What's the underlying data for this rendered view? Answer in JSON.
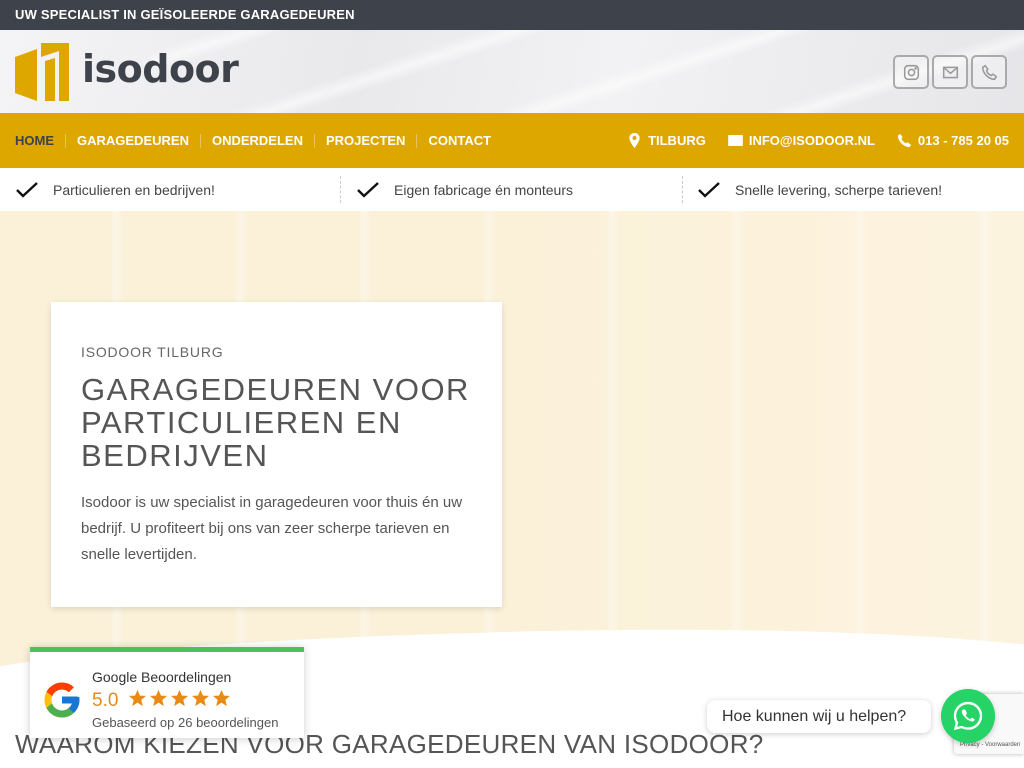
{
  "topbar": {
    "text": "UW SPECIALIST IN GEÏSOLEERDE GARAGEDEUREN"
  },
  "logo": {
    "text": "isodoor"
  },
  "social": [
    {
      "icon": "instagram-icon"
    },
    {
      "icon": "mail-icon"
    },
    {
      "icon": "phone-icon"
    }
  ],
  "nav": {
    "items": [
      "HOME",
      "GARAGEDEUREN",
      "ONDERDELEN",
      "PROJECTEN",
      "CONTACT"
    ],
    "location": "TILBURG",
    "email": "INFO@ISODOOR.NL",
    "phone": "013 - 785 20 05"
  },
  "usp": [
    "Particulieren en bedrijven!",
    "Eigen fabricage én monteurs",
    "Snelle levering, scherpe tarieven!"
  ],
  "hero": {
    "kicker": "ISODOOR TILBURG",
    "title": "GARAGEDEUREN VOOR PARTICULIEREN EN BEDRIJVEN",
    "body": "Isodoor is uw specialist in garagedeuren voor thuis én uw bedrijf. U profiteert bij ons van zeer scherpe tarieven en snelle levertijden."
  },
  "section": {
    "heading": "WAAROM KIEZEN VOOR GARAGEDEUREN VAN ISODOOR?"
  },
  "google_review": {
    "title": "Google Beoordelingen",
    "score": "5.0",
    "stars": 5,
    "based_on": "Gebaseerd op 26 beoordelingen"
  },
  "chat": {
    "prompt": "Hoe kunnen wij u helpen?"
  },
  "recaptcha": {
    "text": "Privacy - Voorwaarden"
  },
  "colors": {
    "accent": "#dea700",
    "dark": "#3d424b",
    "whatsapp": "#25d366",
    "star": "#e98a15"
  }
}
